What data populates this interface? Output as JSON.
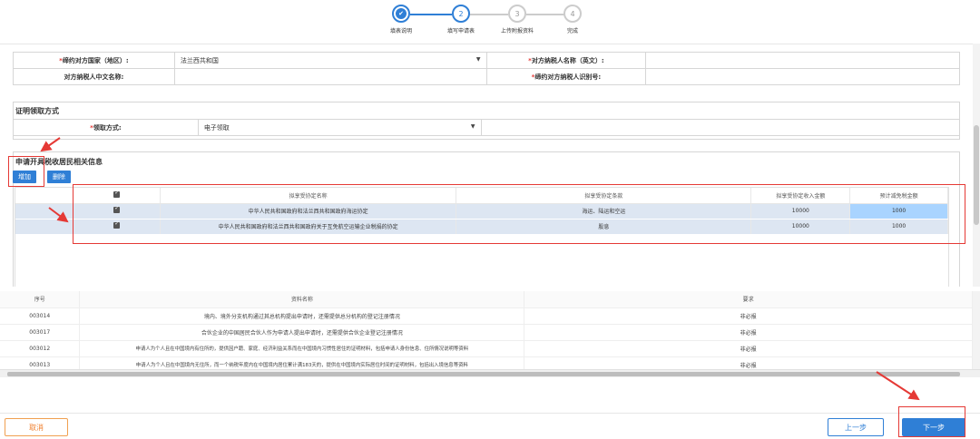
{
  "stepper": {
    "steps": [
      {
        "num": "✔",
        "label": "填表说明"
      },
      {
        "num": "2",
        "label": "填写申请表"
      },
      {
        "num": "3",
        "label": "上传附报资料"
      },
      {
        "num": "4",
        "label": "完成"
      }
    ]
  },
  "form": {
    "country_label": "缔约对方国家（地区）:",
    "country_value": "法兰西共和国",
    "name_en_label": "对方纳税人名称（英文）:",
    "name_en_value": "",
    "name_cn_label": "对方纳税人中文名称:",
    "name_cn_value": "",
    "tin_label": "缔约对方纳税人识别号:",
    "tin_value": ""
  },
  "cert_section": {
    "title": "证明领取方式",
    "method_label": "领取方式:",
    "method_value": "电子领取"
  },
  "resident_section": {
    "title": "申请开具税收居民相关信息",
    "add_label": "增加",
    "delete_label": "删除",
    "headers": [
      "拟享受协定名称",
      "拟享受协定条款",
      "拟享受协定收入金额",
      "预计减免税金额"
    ],
    "rows": [
      {
        "agreement": "中华人民共和国政府和法兰西共和国政府海运协定",
        "clause": "海运、陆运和空运",
        "income": "10000",
        "reduction": "1000"
      },
      {
        "agreement": "中华人民共和国政府和法兰西共和国政府关于互免航空运输企业税捐的协定",
        "clause": "股息",
        "income": "10000",
        "reduction": "1000"
      }
    ]
  },
  "materials": {
    "headers": [
      "序号",
      "资料名称",
      "要求"
    ],
    "rows": [
      {
        "id": "003014",
        "name": "境内、境外分支机构通过其总机构提出申请时，还需提供总分机构的登记注册情况",
        "req": "非必报"
      },
      {
        "id": "003017",
        "name": "合伙企业的中国居民合伙人作为申请人提出申请时，还需提供合伙企业登记注册情况",
        "req": "非必报"
      },
      {
        "id": "003012",
        "name": "申请人为个人且在中国境内有住所的，提供因户籍、家庭、经济利益关系而在中国境内习惯性居住的证明材料，包括申请人身份信息、住所情况说明等资料",
        "req": "非必报"
      },
      {
        "id": "003013",
        "name": "申请人为个人且在中国境内无住所，而一个纳税年度内在中国境内居住累计满183天的，提供在中国境内实际居住时间的证明材料，包括出入境信息等资料",
        "req": "非必报"
      }
    ]
  },
  "footer": {
    "cancel": "取消",
    "prev": "上一步",
    "next": "下一步"
  },
  "colors": {
    "accent": "#2f7fd6",
    "annotation": "#e53935",
    "cancel": "#f08030"
  }
}
